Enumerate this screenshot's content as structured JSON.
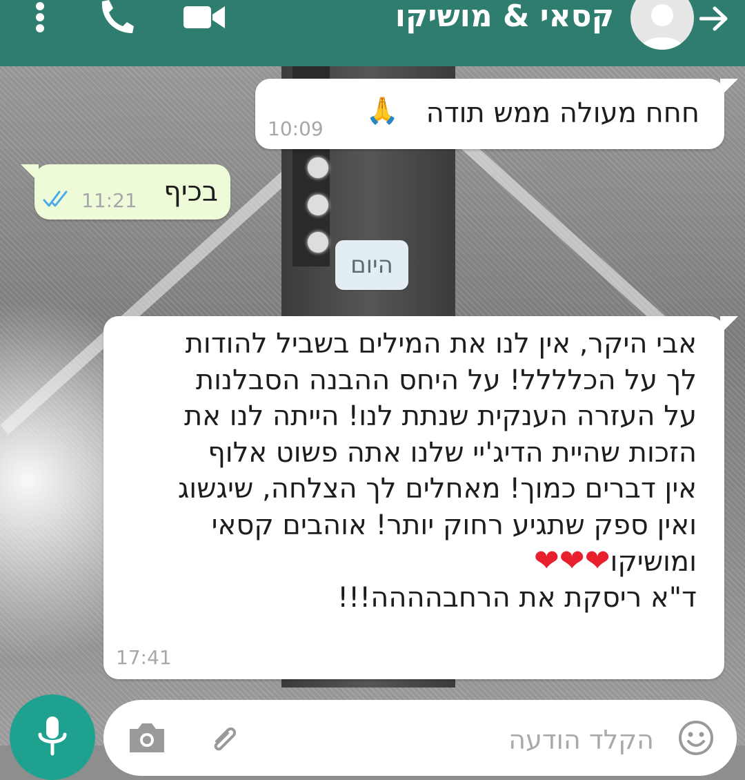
{
  "header": {
    "title": "קסאי & מושיקו",
    "icons": [
      "back-arrow-icon",
      "avatar",
      "video-call-icon",
      "phone-icon",
      "more-menu-icon"
    ],
    "color": "#2e7d6f"
  },
  "messages": [
    {
      "direction": "incoming",
      "text": "חחח מעולה ממש תודה",
      "emoji": "🙏",
      "time": "10:09"
    },
    {
      "direction": "outgoing",
      "text": "בכיף",
      "time": "11:21",
      "status": "read",
      "status_icon": "double-check-icon",
      "status_color": "#49a9ea"
    },
    {
      "direction": "incoming",
      "lines": [
        "אבי היקר, אין לנו את המילים בשביל להודות",
        "לך על הכלללל! על היחס ההבנה הסבלנות",
        "על העזרה הענקית שנתת לנו! הייתה לנו את",
        "הזכות שהיית הדיג'יי שלנו אתה פשוט אלוף",
        "אין דברים כמוך! מאחלים לך הצלחה, שיגשוג",
        "ואין ספק שתגיע רחוק יותר! אוהבים קסאי",
        "ומושיקו",
        "ד\"א ריסקת את הרחבהההה!!!"
      ],
      "hearts": "❤❤❤",
      "time": "17:41"
    }
  ],
  "date_divider": "היום",
  "composer": {
    "placeholder": "הקלד הודעה",
    "icons": [
      "emoji-icon",
      "attach-icon",
      "camera-icon",
      "mic-icon"
    ]
  }
}
